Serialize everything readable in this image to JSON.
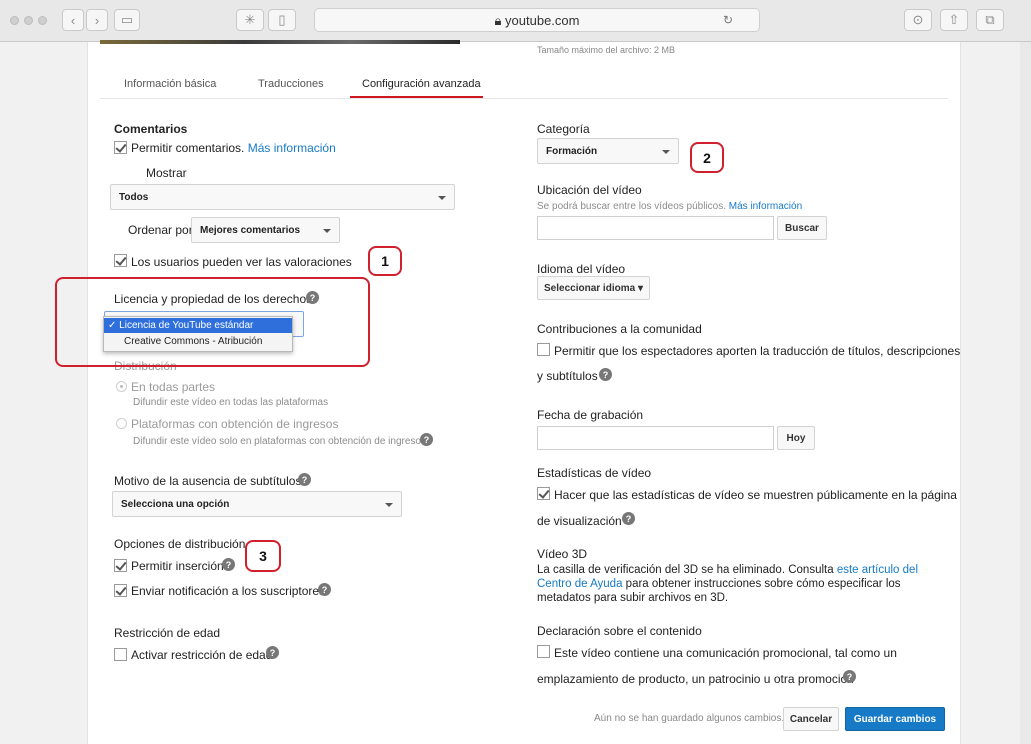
{
  "browser": {
    "url": "youtube.com"
  },
  "file_note": "Tamaño máximo del archivo: 2 MB",
  "tabs": [
    "Información básica",
    "Traducciones",
    "Configuración avanzada"
  ],
  "left": {
    "comments": {
      "title": "Comentarios",
      "allow_label": "Permitir comentarios.",
      "more_info": "Más información",
      "show_label": "Mostrar",
      "show_value": "Todos",
      "sort_label": "Ordenar por",
      "sort_value": "Mejores comentarios",
      "ratings_label": "Los usuarios pueden ver las valoraciones"
    },
    "license": {
      "title": "Licencia y propiedad de los derechos",
      "options": [
        "Licencia de YouTube estándar",
        "Creative Commons - Atribución"
      ],
      "selected_mark": "✓"
    },
    "distribution": {
      "title": "Distribución",
      "everywhere": "En todas partes",
      "everywhere_desc": "Difundir este vídeo en todas las plataformas",
      "monetized": "Plataformas con obtención de ingresos",
      "monetized_desc": "Difundir este vídeo solo en plataformas con obtención de ingresos"
    },
    "subtitles": {
      "title": "Motivo de la ausencia de subtítulos",
      "value": "Selecciona una opción"
    },
    "dist_options": {
      "title": "Opciones de distribución",
      "embed": "Permitir inserción",
      "notify": "Enviar notificación a los suscriptores"
    },
    "age": {
      "title": "Restricción de edad",
      "label": "Activar restricción de edad"
    }
  },
  "right": {
    "category": {
      "title": "Categoría",
      "value": "Formación"
    },
    "location": {
      "title": "Ubicación del vídeo",
      "desc": "Se podrá buscar entre los vídeos públicos.",
      "more_info": "Más información",
      "button": "Buscar"
    },
    "language": {
      "title": "Idioma del vídeo",
      "value": "Seleccionar idioma"
    },
    "community": {
      "title": "Contribuciones a la comunidad",
      "line1": "Permitir que los espectadores aporten la traducción de títulos, descripciones",
      "line2": "y subtítulos"
    },
    "recording": {
      "title": "Fecha de grabación",
      "button": "Hoy"
    },
    "stats": {
      "title": "Estadísticas de vídeo",
      "line1": "Hacer que las estadísticas de vídeo se muestren públicamente en la página",
      "line2": "de visualización"
    },
    "video3d": {
      "title": "Vídeo 3D",
      "line1a": "La casilla de verificación del 3D se ha eliminado. Consulta",
      "line1b": "este artículo del",
      "line2a": "Centro de Ayuda",
      "line2b": "para obtener instrucciones sobre cómo especificar los",
      "line3": "metadatos para subir archivos en 3D."
    },
    "content": {
      "title": "Declaración sobre el contenido",
      "line1": "Este vídeo contiene una comunicación promocional, tal como un",
      "line2": "emplazamiento de producto, un patrocinio u otra promoción"
    }
  },
  "footer": {
    "status": "Aún no se han guardado algunos cambios.",
    "cancel": "Cancelar",
    "save": "Guardar cambios"
  },
  "annotations": [
    "1",
    "2",
    "3"
  ],
  "help_glyph": "?",
  "colors": {
    "accent_red": "#cc181e",
    "link_blue": "#167ac6",
    "primary_button": "#167ac6",
    "annotation": "#d0202e"
  }
}
